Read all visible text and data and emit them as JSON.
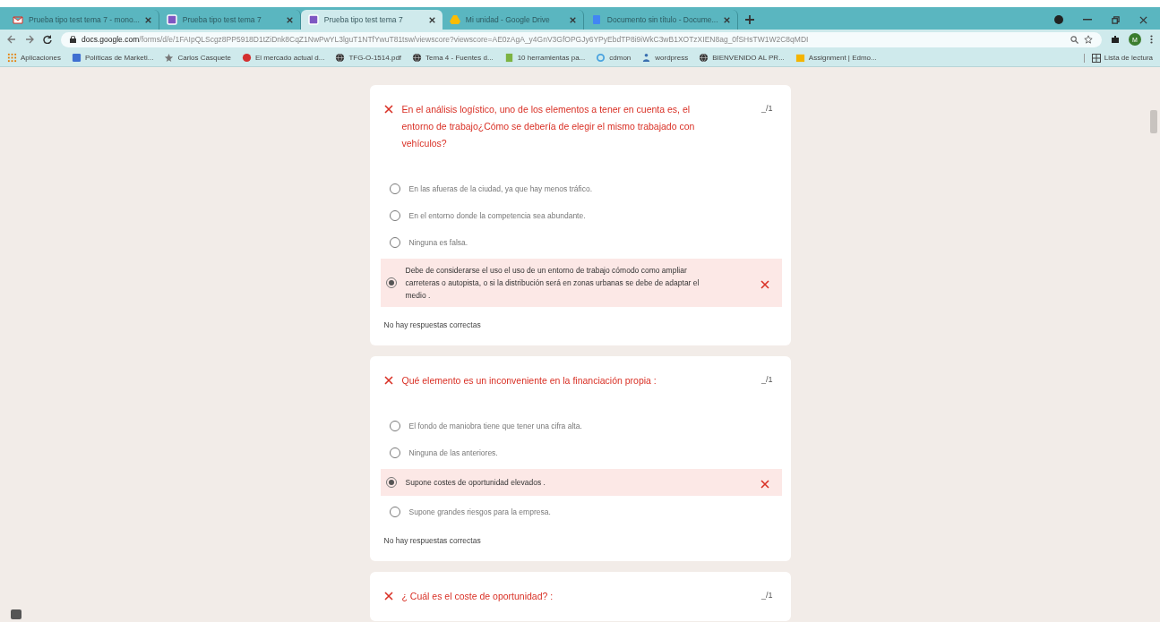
{
  "tabs": [
    {
      "title": "Prueba tipo test tema 7 - mono...",
      "selected": false
    },
    {
      "title": "Prueba tipo test tema 7",
      "selected": false
    },
    {
      "title": "Prueba tipo test tema 7",
      "selected": true
    },
    {
      "title": "Mi unidad - Google Drive",
      "selected": false
    },
    {
      "title": "Documento sin título - Docume...",
      "selected": false
    }
  ],
  "address": {
    "host": "docs.google.com",
    "path": "/forms/d/e/1FAIpQLScgz8PP5918D1tZiDnk8CqZ1NwPwYL3lguT1NTfYwuT81tsw/viewscore?viewscore=AE0zAgA_y4GnV3GfOPGJy6YPyEbdTP8i9iWkC3wB1XOTzXIEN8ag_0fSHsTW1W2C8qMDI"
  },
  "profile": {
    "initials": "M"
  },
  "bookmarks": [
    {
      "label": "Aplicaciones"
    },
    {
      "label": "Políticas de Marketi..."
    },
    {
      "label": "Carlos Casquete"
    },
    {
      "label": "El mercado actual d..."
    },
    {
      "label": "TFG-O-1514.pdf"
    },
    {
      "label": "Tema 4 - Fuentes d..."
    },
    {
      "label": "10 herramientas pa..."
    },
    {
      "label": "cdmon"
    },
    {
      "label": "wordpress"
    },
    {
      "label": "BIENVENIDO AL PR..."
    },
    {
      "label": "Assignment | Edmo..."
    }
  ],
  "reading_list": {
    "label": "Lista de lectura"
  },
  "questions": [
    {
      "title": "En el análisis logístico, uno de los elementos a tener en cuenta es, el entorno de trabajo¿Cómo se debería de elegir el mismo trabajado con vehículos?",
      "incorrect": true,
      "score": "_/1",
      "options": [
        {
          "text": "En las afueras de la ciudad, ya que hay menos tráfico.",
          "selected": false,
          "incorrect": false
        },
        {
          "text": "En el entorno donde la competencia sea abundante.",
          "selected": false,
          "incorrect": false
        },
        {
          "text": "Ninguna es falsa.",
          "selected": false,
          "incorrect": false
        },
        {
          "text": "Debe de considerarse el uso el uso de un entorno de trabajo cómodo como ampliar carreteras o autopista, o si la distribución será en zonas urbanas se debe de adaptar el medio .",
          "selected": true,
          "incorrect": true
        }
      ],
      "feedback": "No hay respuestas correctas"
    },
    {
      "title": "Qué elemento es un inconveniente en la financiación propia :",
      "incorrect": true,
      "score": "_/1",
      "options": [
        {
          "text": "El fondo de maniobra tiene que tener una cifra alta.",
          "selected": false,
          "incorrect": false
        },
        {
          "text": "Ninguna de las anteriores.",
          "selected": false,
          "incorrect": false
        },
        {
          "text": "Supone costes de oportunidad elevados .",
          "selected": true,
          "incorrect": true
        },
        {
          "text": "Supone grandes riesgos para la empresa.",
          "selected": false,
          "incorrect": false
        }
      ],
      "feedback": "No hay respuestas correctas"
    },
    {
      "title": "¿ Cuál es el coste de oportunidad? :",
      "incorrect": true,
      "score": "_/1"
    }
  ]
}
